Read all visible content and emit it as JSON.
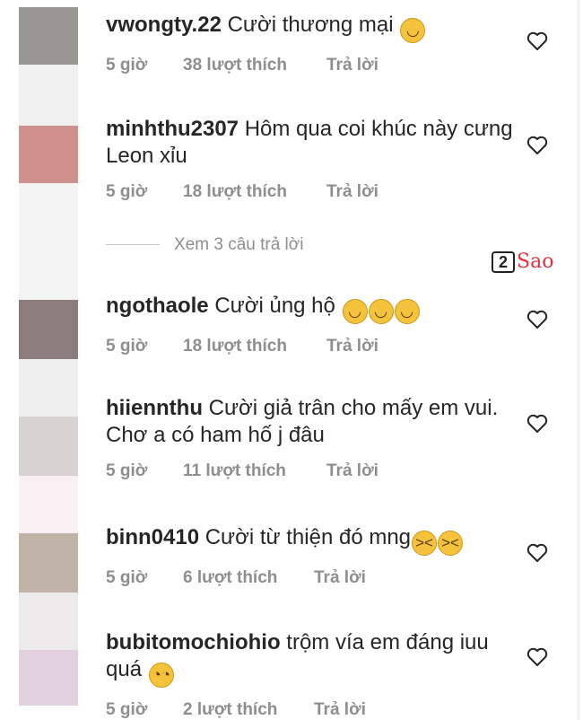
{
  "avatar_colors": [
    "#999793",
    "#f0f0f0",
    "#cf918d",
    "#f4f4f4",
    "#f3f3f3",
    "#8c7c7b",
    "#efefef",
    "#efefef",
    "#d8d3d2",
    "#f9f0f3",
    "#c0b4a8",
    "#edeaec",
    "#e0d0e0"
  ],
  "reply_toggle": "Xem 3 câu trả lời",
  "logo": {
    "num": "2",
    "text": "Sao"
  },
  "comments": [
    {
      "username": "vwongty.22",
      "text": "Cười thương mại",
      "emojis": [
        "😂"
      ],
      "time": "5 giờ",
      "likes": "38 lượt thích",
      "reply": "Trả lời"
    },
    {
      "username": "minhthu2307",
      "text": "Hôm qua coi khúc này cưng Leon  xỉu",
      "emojis": [],
      "time": "5 giờ",
      "likes": "18 lượt thích",
      "reply": "Trả lời"
    },
    {
      "username": "ngothaole",
      "text": "Cười ủng hộ",
      "emojis": [
        "😂",
        "😂",
        "😂"
      ],
      "time": "5 giờ",
      "likes": "18 lượt thích",
      "reply": "Trả lời"
    },
    {
      "username": "hiiennthu",
      "text": "Cười giả trân cho mấy em vui. Chơ a có ham hố j đâu",
      "emojis": [],
      "time": "5 giờ",
      "likes": "11 lượt thích",
      "reply": "Trả lời"
    },
    {
      "username": "binn0410",
      "text": "Cười từ thiện đó mng",
      "emojis": [
        "😆",
        "😆"
      ],
      "time": "5 giờ",
      "likes": "6 lượt thích",
      "reply": "Trả lời"
    },
    {
      "username": "bubitomochiohio",
      "text": "trộm vía em đáng iuu quá",
      "emojis": [
        "🥺"
      ],
      "time": "5 giờ",
      "likes": "2 lượt thích",
      "reply": "Trả lời"
    }
  ]
}
